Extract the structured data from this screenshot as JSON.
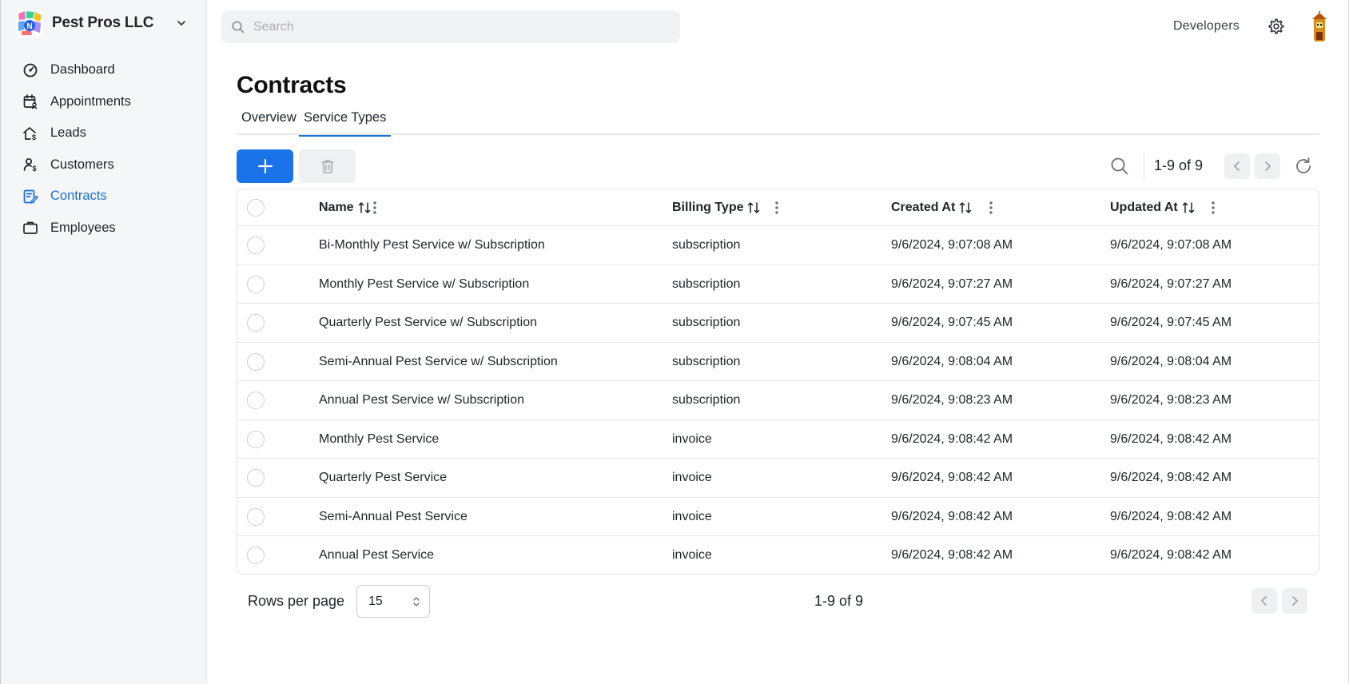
{
  "org": {
    "name": "Pest Pros LLC"
  },
  "sidebar": {
    "items": [
      {
        "label": "Dashboard",
        "icon": "dashboard-gauge-icon"
      },
      {
        "label": "Appointments",
        "icon": "calendar-user-icon"
      },
      {
        "label": "Leads",
        "icon": "house-dollar-icon"
      },
      {
        "label": "Customers",
        "icon": "user-dollar-icon"
      },
      {
        "label": "Contracts",
        "icon": "contract-edit-icon",
        "active": true
      },
      {
        "label": "Employees",
        "icon": "briefcase-icon"
      }
    ]
  },
  "header": {
    "search_placeholder": "Search",
    "developers_label": "Developers"
  },
  "page": {
    "title": "Contracts",
    "tabs": [
      {
        "label": "Overview"
      },
      {
        "label": "Service Types",
        "active": true
      }
    ]
  },
  "toolbar": {
    "range": "1-9 of 9"
  },
  "table": {
    "columns": [
      "Name",
      "Billing Type",
      "Created At",
      "Updated At"
    ],
    "rows": [
      {
        "name": "Bi-Monthly Pest Service w/ Subscription",
        "billing": "subscription",
        "created": "9/6/2024, 9:07:08 AM",
        "updated": "9/6/2024, 9:07:08 AM"
      },
      {
        "name": "Monthly Pest Service w/ Subscription",
        "billing": "subscription",
        "created": "9/6/2024, 9:07:27 AM",
        "updated": "9/6/2024, 9:07:27 AM"
      },
      {
        "name": "Quarterly Pest Service w/ Subscription",
        "billing": "subscription",
        "created": "9/6/2024, 9:07:45 AM",
        "updated": "9/6/2024, 9:07:45 AM"
      },
      {
        "name": "Semi-Annual Pest Service w/ Subscription",
        "billing": "subscription",
        "created": "9/6/2024, 9:08:04 AM",
        "updated": "9/6/2024, 9:08:04 AM"
      },
      {
        "name": "Annual Pest Service w/ Subscription",
        "billing": "subscription",
        "created": "9/6/2024, 9:08:23 AM",
        "updated": "9/6/2024, 9:08:23 AM"
      },
      {
        "name": "Monthly Pest Service",
        "billing": "invoice",
        "created": "9/6/2024, 9:08:42 AM",
        "updated": "9/6/2024, 9:08:42 AM"
      },
      {
        "name": "Quarterly Pest Service",
        "billing": "invoice",
        "created": "9/6/2024, 9:08:42 AM",
        "updated": "9/6/2024, 9:08:42 AM"
      },
      {
        "name": "Semi-Annual Pest Service",
        "billing": "invoice",
        "created": "9/6/2024, 9:08:42 AM",
        "updated": "9/6/2024, 9:08:42 AM"
      },
      {
        "name": "Annual Pest Service",
        "billing": "invoice",
        "created": "9/6/2024, 9:08:42 AM",
        "updated": "9/6/2024, 9:08:42 AM"
      }
    ]
  },
  "footer": {
    "rows_per_page_label": "Rows per page",
    "rows_per_page_value": "15",
    "range": "1-9 of 9"
  },
  "colors": {
    "accent": "#1a73e8",
    "active_nav": "#1a6fd9",
    "sidebar_bg": "#f5f6f8"
  }
}
